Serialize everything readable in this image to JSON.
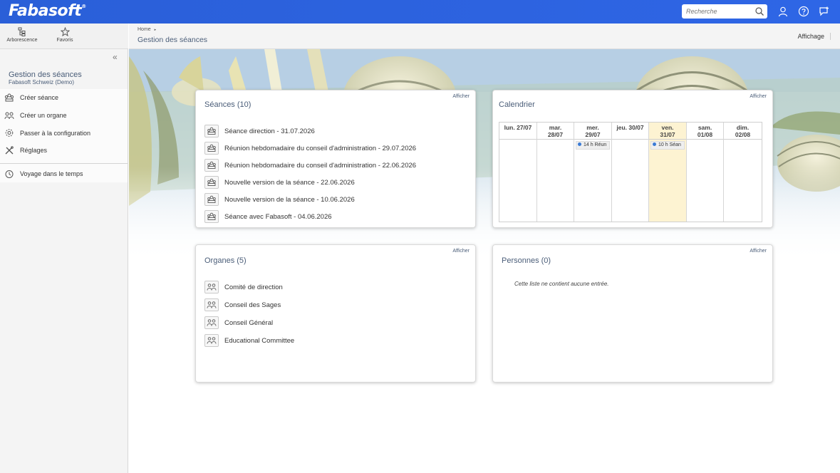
{
  "header": {
    "logo": "Fabasoft",
    "logo_mark": "®",
    "search_placeholder": "Recherche",
    "icons": [
      "search-icon",
      "user-icon",
      "help-icon",
      "feedback-icon"
    ]
  },
  "sidebar": {
    "tools": [
      {
        "label": "Arborescence",
        "icon": "tree-icon"
      },
      {
        "label": "Favoris",
        "icon": "star-icon"
      }
    ],
    "collapse_label": "«",
    "title": "Gestion des séances",
    "subtitle": "Fabasoft Schweiz (Demo)",
    "actions": [
      {
        "label": "Créer séance",
        "icon": "meeting-icon"
      },
      {
        "label": "Créer un organe",
        "icon": "group-icon"
      },
      {
        "label": "Passer à la configuration",
        "icon": "gear-icon"
      },
      {
        "label": "Réglages",
        "icon": "tools-icon"
      }
    ],
    "extra": {
      "label": "Voyage dans le temps",
      "icon": "clock-icon"
    }
  },
  "breadcrumb": {
    "home": "Home",
    "separator": "▸"
  },
  "page_title": "Gestion des séances",
  "view_label": "Affichage",
  "cards": {
    "seances": {
      "title": "Séances (10)",
      "link": "Afficher",
      "items": [
        "Séance direction - 31.07.2026",
        "Réunion hebdomadaire du conseil d'administration - 29.07.2026",
        "Réunion hebdomadaire du conseil d'administration - 22.06.2026",
        "Nouvelle version de la séance - 22.06.2026",
        "Nouvelle version de la séance - 10.06.2026",
        "Séance avec Fabasoft - 04.06.2026"
      ]
    },
    "calendrier": {
      "title": "Calendrier",
      "link": "Afficher",
      "days": [
        {
          "line1": "lun. 27/07",
          "line2": ""
        },
        {
          "line1": "mar.",
          "line2": "28/07"
        },
        {
          "line1": "mer.",
          "line2": "29/07"
        },
        {
          "line1": "jeu. 30/07",
          "line2": ""
        },
        {
          "line1": "ven.",
          "line2": "31/07"
        },
        {
          "line1": "sam.",
          "line2": "01/08"
        },
        {
          "line1": "dim.",
          "line2": "02/08"
        }
      ],
      "events": [
        {
          "day": 2,
          "text": "14 h Réun"
        },
        {
          "day": 4,
          "text": "10 h Séan"
        }
      ],
      "highlight_day": 4,
      "highlight_color": "#fdf3d2"
    },
    "organes": {
      "title": "Organes (5)",
      "link": "Afficher",
      "items": [
        "Comité de direction",
        "Conseil des Sages",
        "Conseil Général",
        "Educational Committee"
      ]
    },
    "personnes": {
      "title": "Personnes (0)",
      "link": "Afficher",
      "empty": "Cette liste ne contient aucune entrée."
    }
  },
  "colors": {
    "accent": "#2d63e0",
    "title_text": "#4a5d78",
    "today": "#fdf3d2"
  }
}
